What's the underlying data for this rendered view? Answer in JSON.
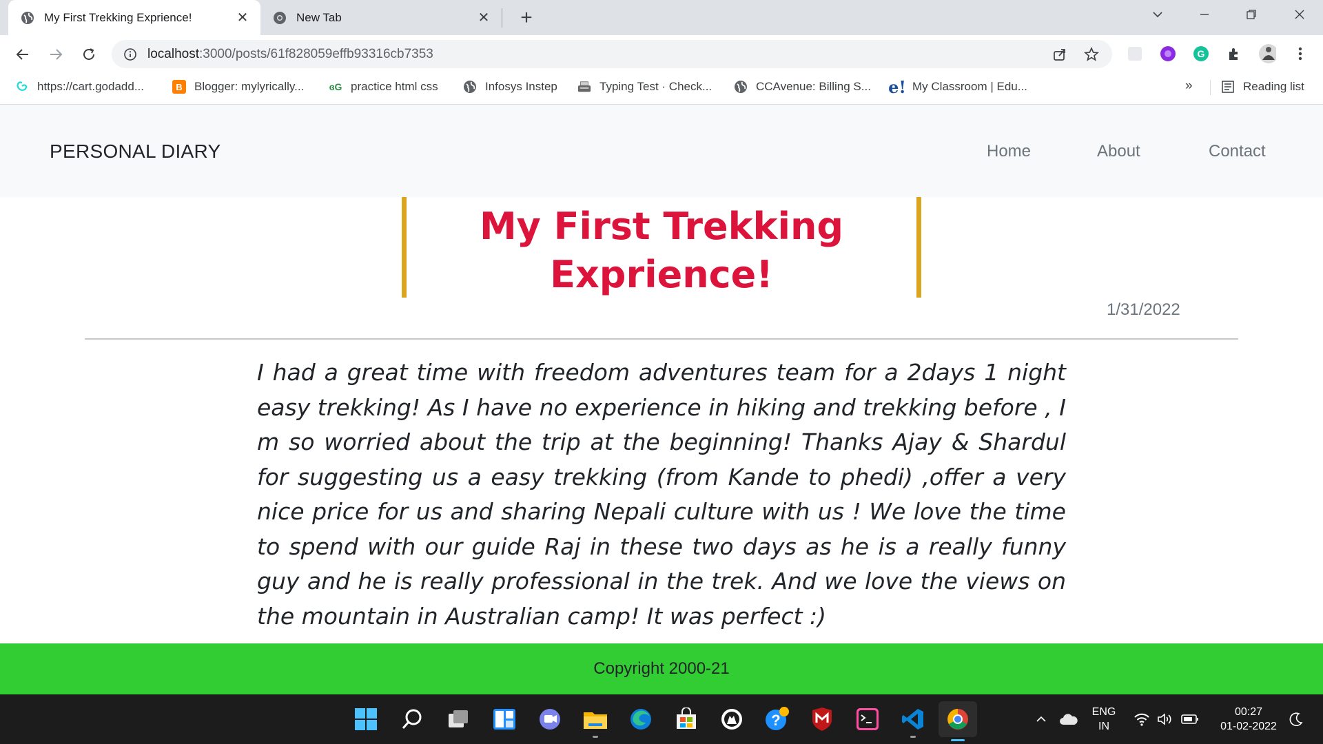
{
  "browser": {
    "tabs": [
      {
        "title": "My First Trekking Exprience!",
        "active": true
      },
      {
        "title": "New Tab",
        "active": false
      }
    ],
    "url": {
      "host": "localhost",
      "path": ":3000/posts/61f828059effb93316cb7353"
    },
    "bookmarks": [
      {
        "label": "https://cart.godadd...",
        "icon": "godaddy-icon"
      },
      {
        "label": "Blogger: mylyrically...",
        "icon": "blogger-icon"
      },
      {
        "label": "practice html css",
        "icon": "geeksforgeeks-icon"
      },
      {
        "label": "Infosys Instep",
        "icon": "globe-icon"
      },
      {
        "label": "Typing Test · Check...",
        "icon": "typewriter-icon"
      },
      {
        "label": "CCAvenue: Billing S...",
        "icon": "globe-icon"
      },
      {
        "label": "My Classroom | Edu...",
        "icon": "edureka-icon"
      }
    ],
    "bookmarks_more": "»",
    "reading_list": "Reading list"
  },
  "site": {
    "brand": "PERSONAL DIARY",
    "nav": [
      "Home",
      "About",
      "Contact"
    ]
  },
  "post": {
    "title": "My First Trekking Exprience!",
    "date": "1/31/2022",
    "body": "I had a great time with freedom adventures team for a 2days 1 night easy trekking! As I have no experience in hiking and trekking before , I m so worried about the trip at the beginning! Thanks Ajay & Shardul for suggesting us a easy trekking (from Kande to phedi) ,offer a very nice price for us and sharing Nepali culture with us ! We love the time to spend with our guide Raj in these two days as he is a really funny guy and he is really professional in the trek. And we love the views on the mountain in Australian camp! It was perfect :)"
  },
  "footer": {
    "copyright": "Copyright 2000-21"
  },
  "taskbar": {
    "language": "ENG",
    "region": "IN",
    "time": "00:27",
    "date": "01-02-2022"
  },
  "colors": {
    "title": "#dc143c",
    "title_border": "#daa520",
    "footer": "#32cd32",
    "navbar": "#f8f9fa"
  }
}
